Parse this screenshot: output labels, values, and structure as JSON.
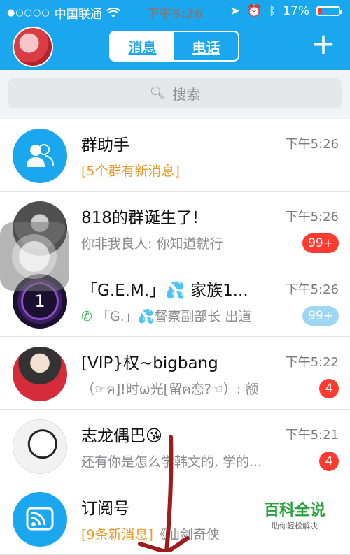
{
  "status_bar": {
    "carrier": "中国联通",
    "signal_dots": "●○○○○",
    "time": "下午5:26",
    "battery": "17%"
  },
  "header": {
    "tabs": [
      {
        "label": "消息",
        "active": true
      },
      {
        "label": "电话",
        "active": false
      }
    ],
    "add_symbol": "+"
  },
  "search": {
    "placeholder": "搜索"
  },
  "conversations": [
    {
      "title": "群助手",
      "time": "下午5:26",
      "subtitle_highlight": "[5个群有新消息]",
      "subtitle": "",
      "badge": ""
    },
    {
      "title": "818的群诞生了!",
      "time": "下午5:26",
      "subtitle_highlight": "",
      "subtitle": "你非我良人: 你知道就行",
      "badge": "99+"
    },
    {
      "title": "「G.E.M.」💦 家族1...",
      "time": "下午5:26",
      "subtitle_highlight": "",
      "subtitle": "「G.」💦督察副部长 出道",
      "badge": "99+"
    },
    {
      "title": "[VIP}权~bigbang",
      "time": "下午5:22",
      "subtitle_highlight": "",
      "subtitle": "（☞ฅ]!时ω光[留ฅ恋?☜）: 额",
      "badge": "4"
    },
    {
      "title": "志龙偶巴😘",
      "time": "下午5:21",
      "subtitle_highlight": "",
      "subtitle": "还有你是怎么学韩文的, 学的...",
      "badge": "4"
    },
    {
      "title": "订阅号",
      "time": "",
      "subtitle_highlight": "[9条新消息]",
      "subtitle": "《仙剑奇侠",
      "badge": ""
    }
  ],
  "gem_avatar_number": "1",
  "watermark": {
    "title": "百科全说",
    "subtitle": "助你轻松解决"
  },
  "colors": {
    "brand_blue": "#1aa7ee",
    "badge_red": "#ff3b30",
    "badge_muted": "#9fd6f3",
    "highlight_orange": "#e59a2a"
  }
}
